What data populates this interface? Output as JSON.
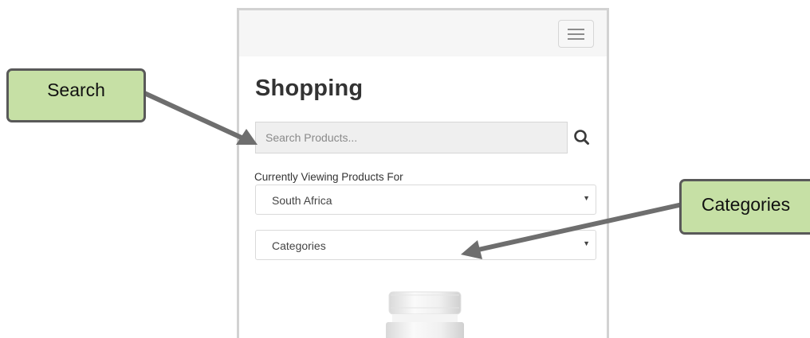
{
  "app": {
    "title": "Shopping",
    "menu_icon": "hamburger-icon"
  },
  "search": {
    "placeholder": "Search Products...",
    "value": "",
    "button_icon": "search-icon"
  },
  "country": {
    "label": "Currently Viewing Products For",
    "selected": "South Africa"
  },
  "categories": {
    "selected": "Categories"
  },
  "product": {
    "image_icon": "product-bottle-image"
  },
  "annotations": {
    "search_callout": "Search",
    "categories_callout": "Categories",
    "callout_color": "#c6e0a5",
    "callout_border_color": "#595959",
    "arrow_color": "#6e6e6e"
  }
}
